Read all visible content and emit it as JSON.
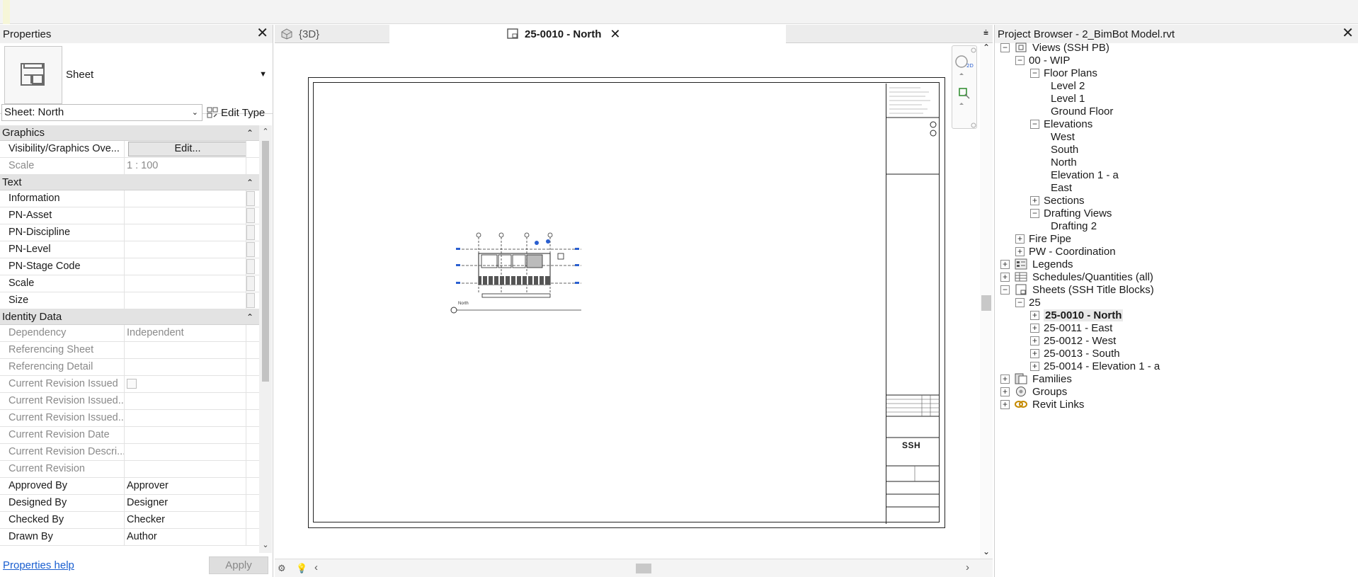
{
  "properties": {
    "title": "Properties",
    "type_name": "Sheet",
    "instance_selector": "Sheet: North",
    "edit_type_label": "Edit Type",
    "groups": {
      "graphics": "Graphics",
      "text": "Text",
      "identity": "Identity Data"
    },
    "graphics_rows": [
      {
        "key": "Visibility/Graphics Ove...",
        "value": "Edit..."
      },
      {
        "key": "Scale",
        "value": "1 : 100"
      }
    ],
    "text_rows": [
      {
        "key": "Information",
        "value": ""
      },
      {
        "key": "PN-Asset",
        "value": ""
      },
      {
        "key": "PN-Discipline",
        "value": ""
      },
      {
        "key": "PN-Level",
        "value": ""
      },
      {
        "key": "PN-Stage Code",
        "value": ""
      },
      {
        "key": "Scale",
        "value": ""
      },
      {
        "key": "Size",
        "value": ""
      }
    ],
    "identity_rows": [
      {
        "key": "Dependency",
        "value": "Independent"
      },
      {
        "key": "Referencing Sheet",
        "value": ""
      },
      {
        "key": "Referencing Detail",
        "value": ""
      },
      {
        "key": "Current Revision Issued",
        "value": ""
      },
      {
        "key": "Current Revision Issued...",
        "value": ""
      },
      {
        "key": "Current Revision Issued...",
        "value": ""
      },
      {
        "key": "Current Revision Date",
        "value": ""
      },
      {
        "key": "Current Revision Descri...",
        "value": ""
      },
      {
        "key": "Current Revision",
        "value": ""
      },
      {
        "key": "Approved By",
        "value": "Approver"
      },
      {
        "key": "Designed By",
        "value": "Designer"
      },
      {
        "key": "Checked By",
        "value": "Checker"
      },
      {
        "key": "Drawn By",
        "value": "Author"
      }
    ],
    "help_link": "Properties help",
    "apply_label": "Apply"
  },
  "tabs": [
    {
      "label": "{3D}"
    },
    {
      "label": "25-0010 - North"
    }
  ],
  "drawing": {
    "view_label": "North",
    "title_block_logo": "SSH"
  },
  "browser": {
    "title": "Project Browser - 2_BimBot Model.rvt",
    "nodes": [
      {
        "label": "Views (SSH PB)"
      },
      {
        "label": "00 - WIP"
      },
      {
        "label": "Floor Plans"
      },
      {
        "label": "Level 2"
      },
      {
        "label": "Level 1"
      },
      {
        "label": "Ground Floor"
      },
      {
        "label": "Elevations"
      },
      {
        "label": "West"
      },
      {
        "label": "South"
      },
      {
        "label": "North"
      },
      {
        "label": "Elevation 1 - a"
      },
      {
        "label": "East"
      },
      {
        "label": "Sections"
      },
      {
        "label": "Drafting Views"
      },
      {
        "label": "Drafting 2"
      },
      {
        "label": "Fire Pipe"
      },
      {
        "label": "PW - Coordination"
      },
      {
        "label": "Legends"
      },
      {
        "label": "Schedules/Quantities (all)"
      },
      {
        "label": "Sheets (SSH Title Blocks)"
      },
      {
        "label": "25"
      },
      {
        "label": "25-0010 - North"
      },
      {
        "label": "25-0011 - East"
      },
      {
        "label": "25-0012 - West"
      },
      {
        "label": "25-0013 - South"
      },
      {
        "label": "25-0014 - Elevation 1 - a"
      },
      {
        "label": "Families"
      },
      {
        "label": "Groups"
      },
      {
        "label": "Revit Links"
      }
    ]
  }
}
